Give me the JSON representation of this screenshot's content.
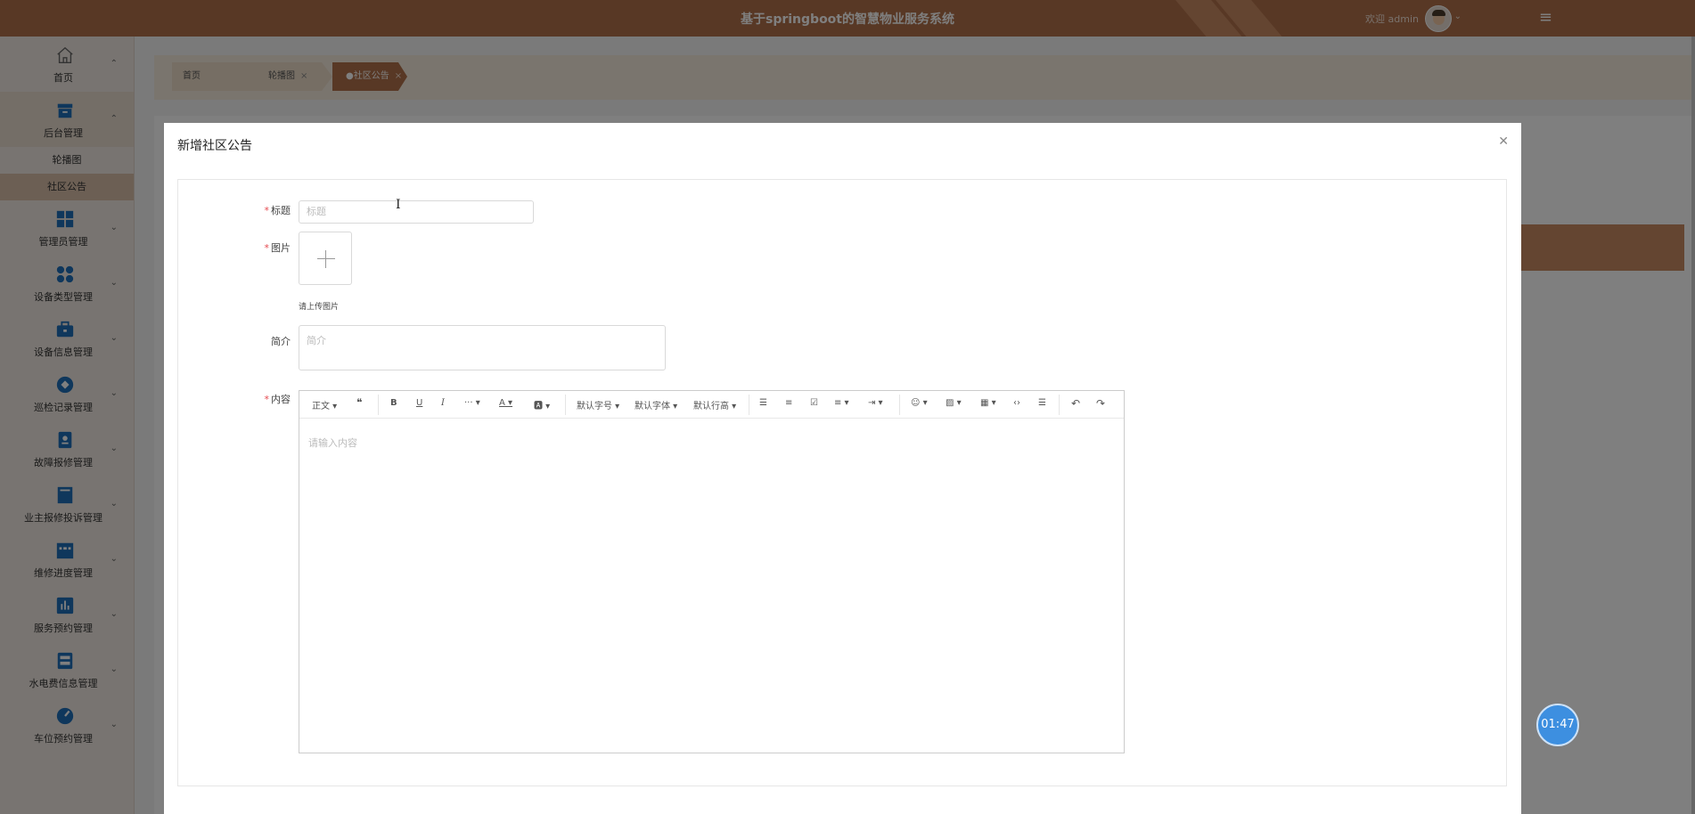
{
  "header": {
    "title": "基于springboot的智慧物业服务系统",
    "welcome": "欢迎 admin",
    "menu_icon": "hamburger-icon"
  },
  "sidebar": {
    "items": [
      {
        "label": "首页",
        "icon": "home-icon"
      },
      {
        "label": "后台管理",
        "icon": "inbox-icon"
      },
      {
        "label": "管理员管理",
        "icon": "grid-icon"
      },
      {
        "label": "设备类型管理",
        "icon": "dots-grid-icon"
      },
      {
        "label": "设备信息管理",
        "icon": "briefcase-icon"
      },
      {
        "label": "巡检记录管理",
        "icon": "diamond-icon"
      },
      {
        "label": "故障报修管理",
        "icon": "id-card-icon"
      },
      {
        "label": "业主报修投诉管理",
        "icon": "monitor-icon"
      },
      {
        "label": "维修进度管理",
        "icon": "shop-icon"
      },
      {
        "label": "服务预约管理",
        "icon": "chart-icon"
      },
      {
        "label": "水电费信息管理",
        "icon": "server-icon"
      },
      {
        "label": "车位预约管理",
        "icon": "gauge-icon"
      }
    ],
    "sub_items": [
      {
        "label": "轮播图"
      },
      {
        "label": "社区公告"
      }
    ]
  },
  "tabs": [
    {
      "label": "首页"
    },
    {
      "label": "轮播图"
    },
    {
      "label": "●社区公告"
    }
  ],
  "dialog": {
    "title": "新增社区公告",
    "fields": {
      "title_label": "标题",
      "title_placeholder": "标题",
      "image_label": "图片",
      "image_hint": "请上传图片",
      "intro_label": "简介",
      "intro_placeholder": "简介",
      "content_label": "内容"
    },
    "editor": {
      "placeholder": "请输入内容",
      "toolbar": {
        "heading": "正文",
        "font_size": "默认字号",
        "font_family": "默认字体",
        "line_height": "默认行高"
      }
    }
  },
  "timer": "01:47"
}
